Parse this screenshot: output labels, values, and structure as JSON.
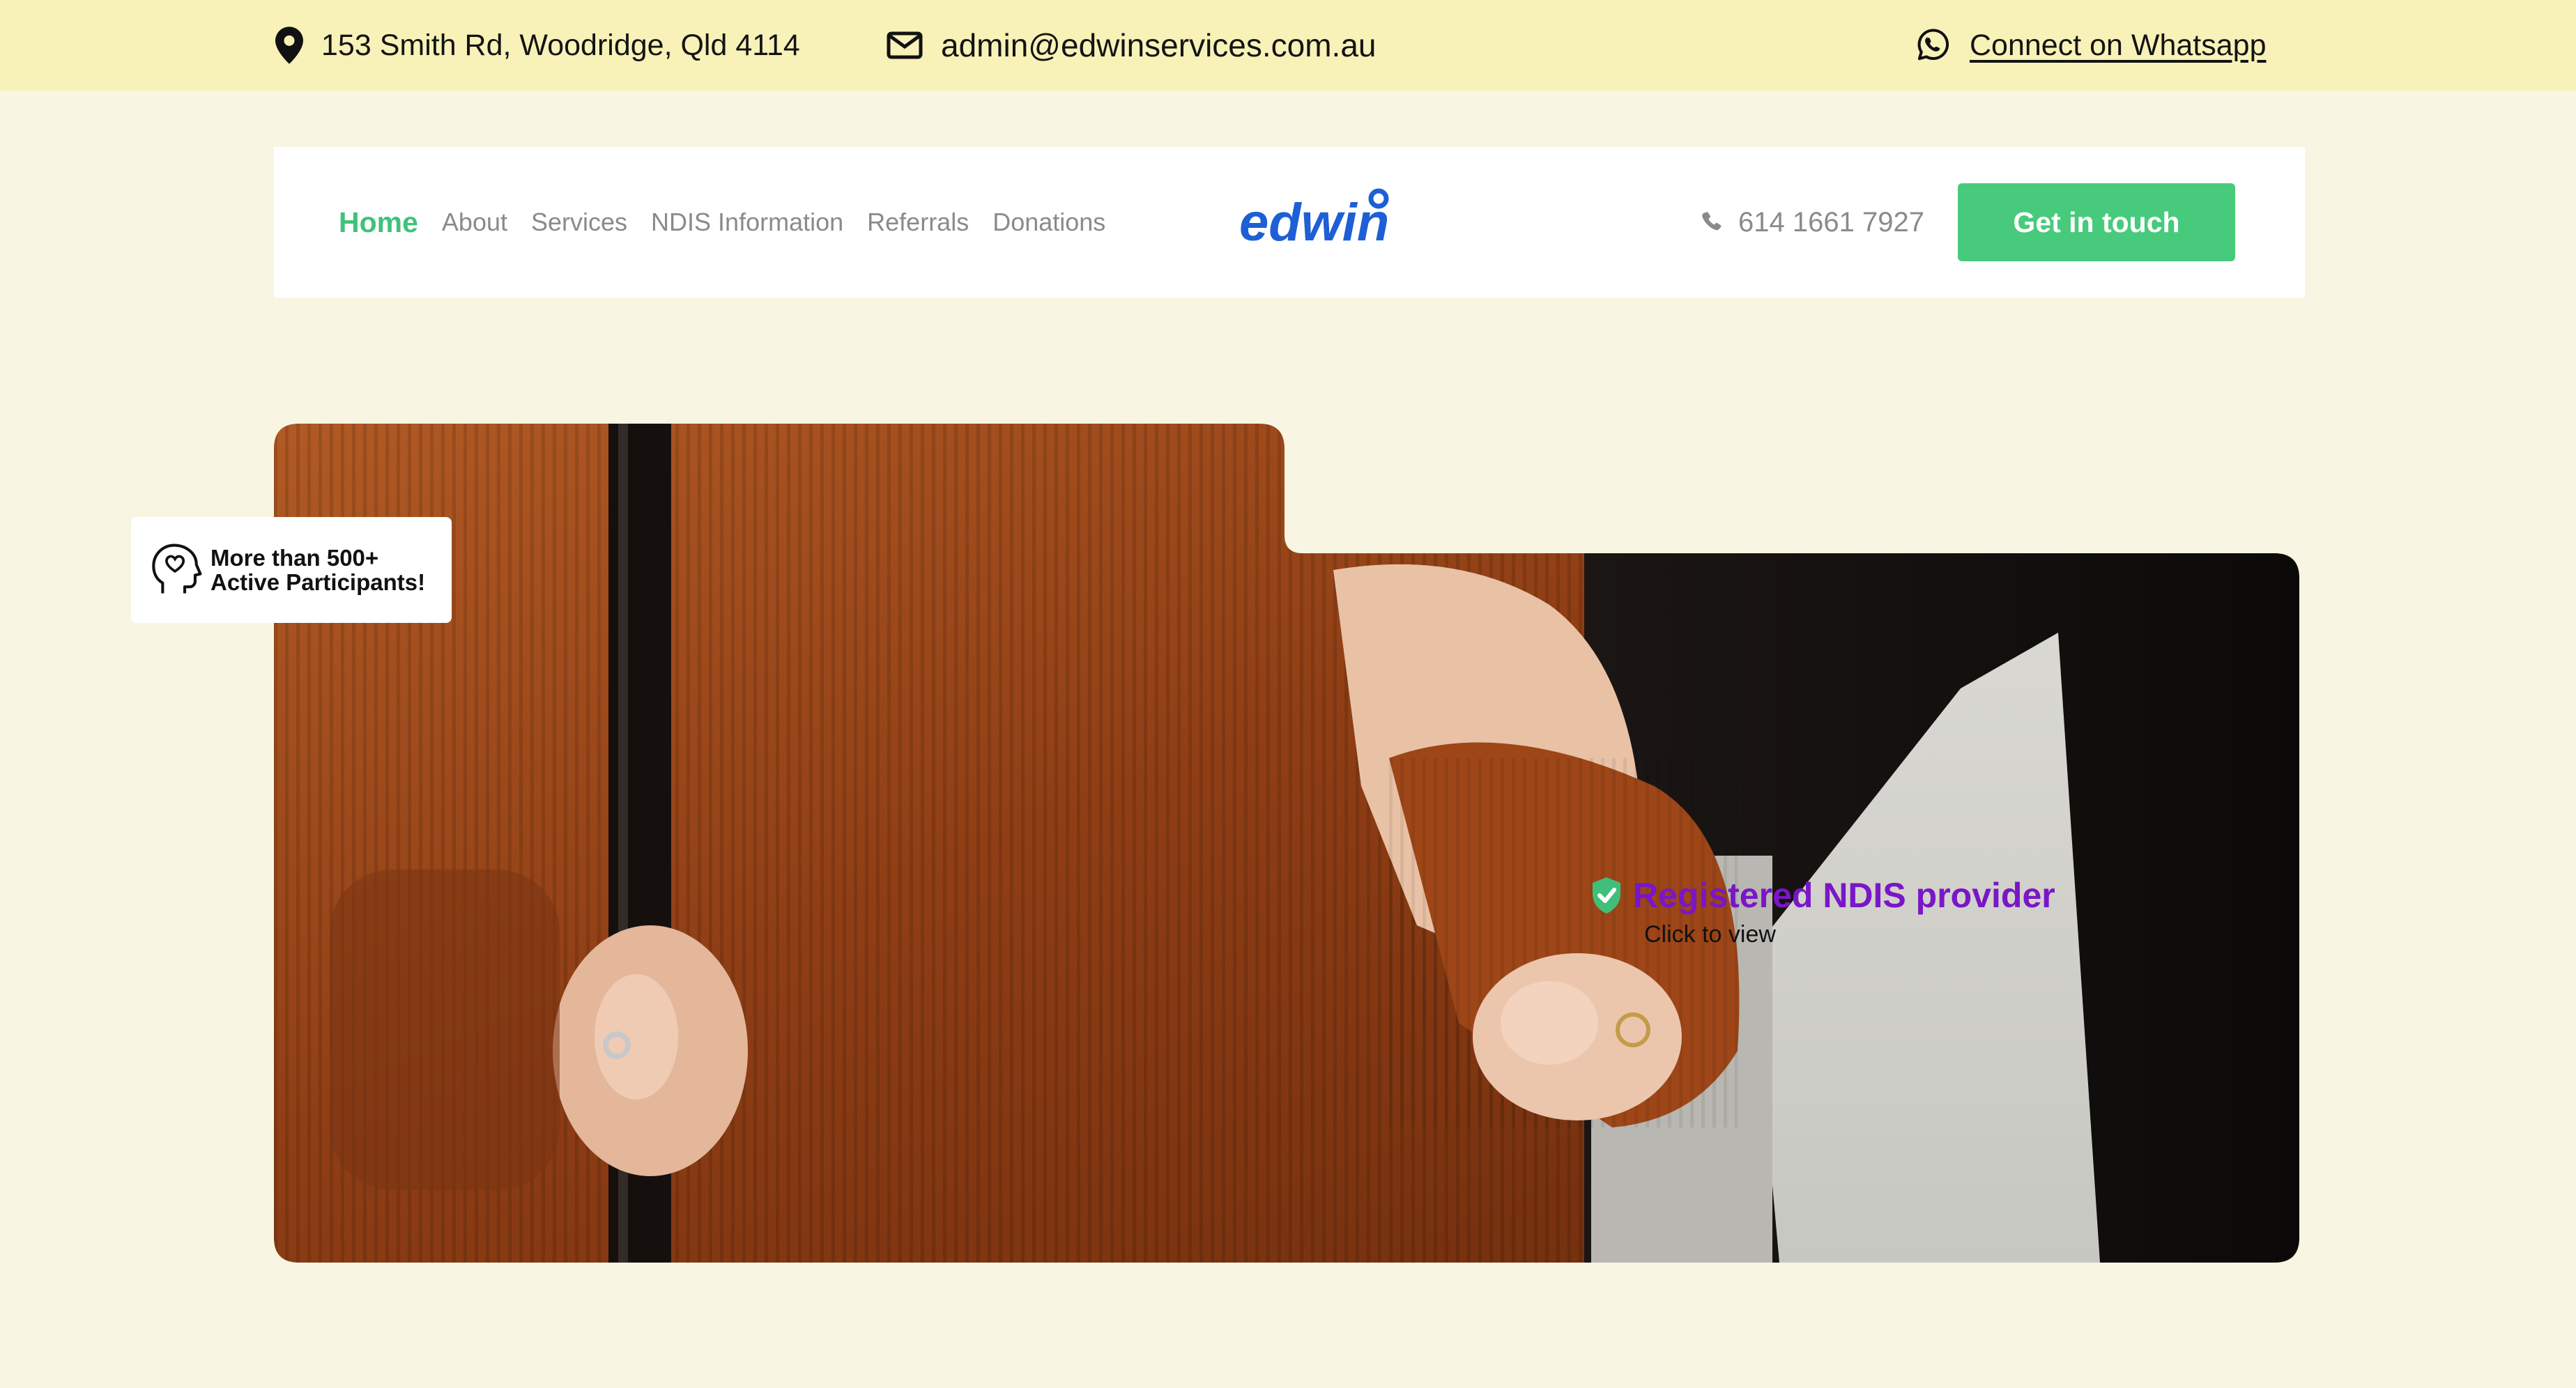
{
  "topbar": {
    "address": "153 Smith Rd, Woodridge, Qld 4114",
    "email": "admin@edwinservices.com.au",
    "whatsapp": "Connect on Whatsapp",
    "icons": [
      "location-pin-icon",
      "mail-icon",
      "whatsapp-icon"
    ]
  },
  "nav": {
    "items": [
      {
        "label": "Home",
        "active": true
      },
      {
        "label": "About"
      },
      {
        "label": "Services"
      },
      {
        "label": "NDIS Information"
      },
      {
        "label": "Referrals"
      },
      {
        "label": "Donations"
      }
    ],
    "logo": "edwin",
    "phone": "614 1661 7927",
    "cta": "Get in touch"
  },
  "hero": {
    "ndis_title": "Registered NDIS provider",
    "ndis_sub": "Click to view",
    "participants_line1": "More than 500+",
    "participants_line2": "Active Participants!"
  },
  "colors": {
    "page_bg": "#f8f6e3",
    "topbar_bg": "#f8f2b8",
    "accent_green": "#48ca7c",
    "brand_blue": "#1e5fd6",
    "ndis_purple": "#7a16c7"
  }
}
